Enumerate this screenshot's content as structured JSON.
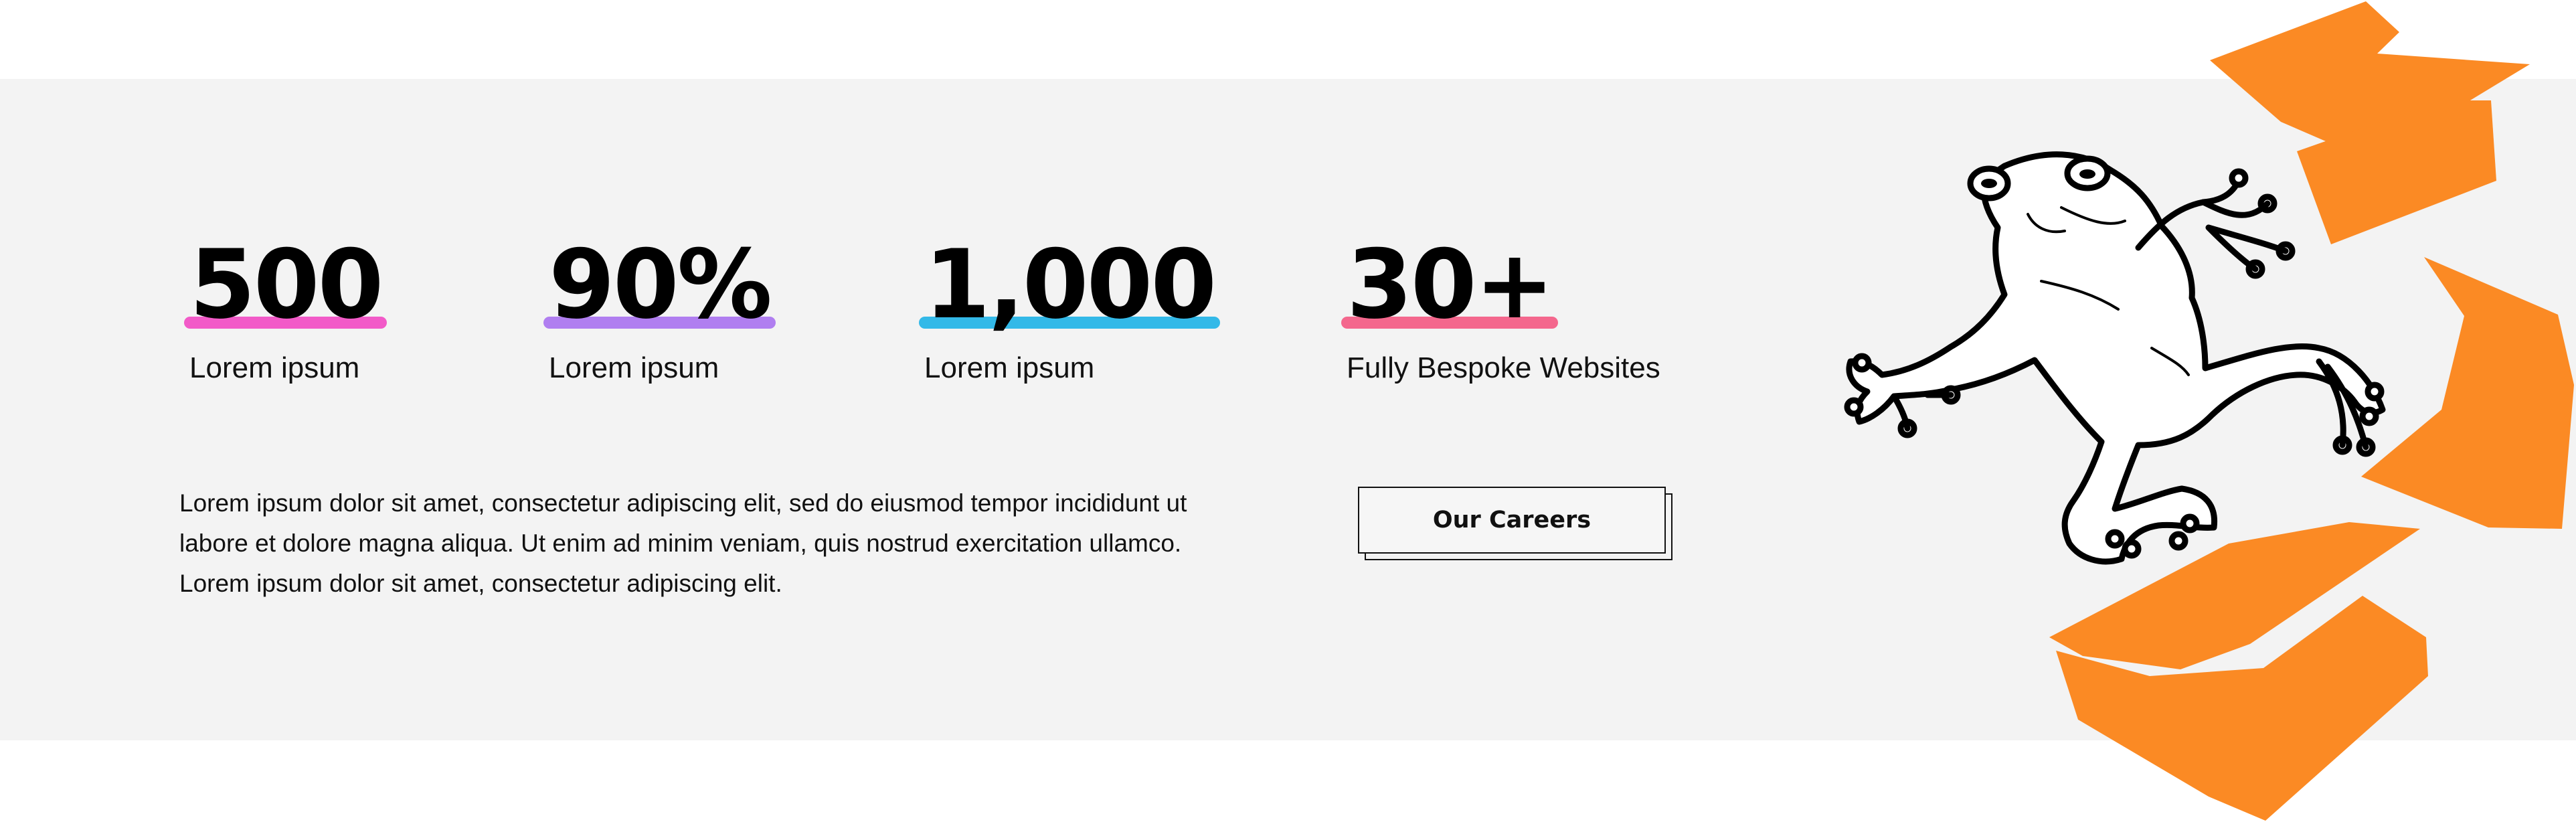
{
  "stats": [
    {
      "value": "500",
      "label": "Lorem ipsum",
      "underline_color": "#f25ac8"
    },
    {
      "value": "90%",
      "label": "Lorem ipsum",
      "underline_color": "#b07ef0"
    },
    {
      "value": "1,000",
      "label": "Lorem ipsum",
      "underline_color": "#33b9e8"
    },
    {
      "value": "30+",
      "label": "Fully Bespoke Websites",
      "underline_color": "#f4678d"
    }
  ],
  "description": "Lorem ipsum dolor sit amet, consectetur adipiscing elit, sed do eiusmod tempor incididunt ut labore et dolore magna aliqua. Ut enim ad minim veniam, quis nostrud exercitation ullamco. Lorem ipsum dolor sit amet, consectetur adipiscing elit.",
  "cta": {
    "label": "Our Careers"
  },
  "colors": {
    "band_background": "#f3f3f3",
    "paper_accent": "#fb8a24",
    "text": "#111111"
  },
  "illustration": {
    "icon": "frog-illustration",
    "papers_icon": "flying-papers-illustration"
  }
}
